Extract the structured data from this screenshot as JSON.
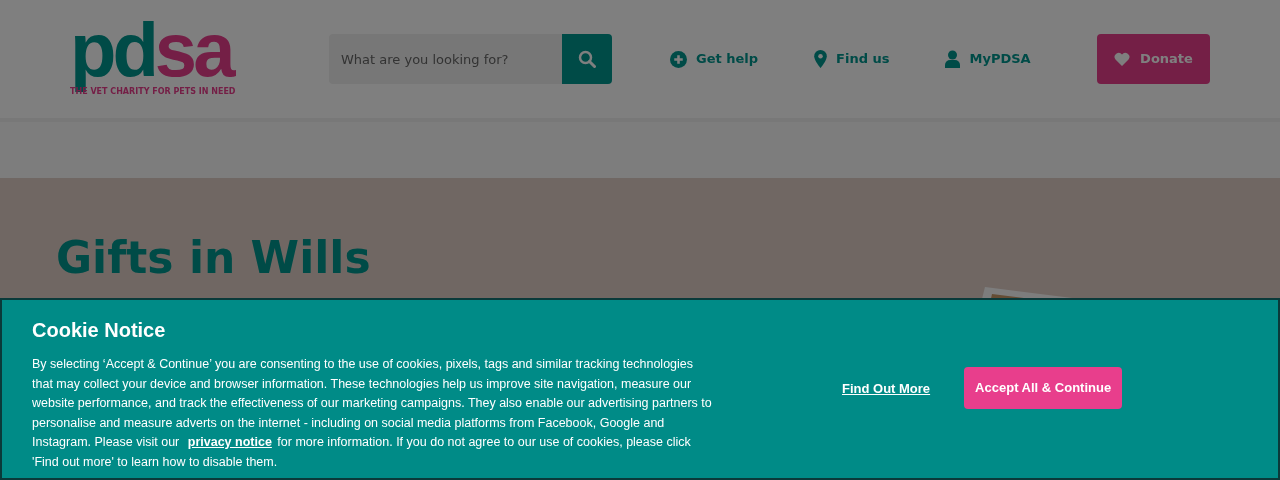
{
  "header": {
    "logo": {
      "part_1": "pd",
      "part_2": "sa",
      "tagline": "THE VET CHARITY FOR PETS IN NEED"
    },
    "search": {
      "placeholder": "What are you looking for?"
    },
    "nav": [
      {
        "kind": "help",
        "label": "Get help"
      },
      {
        "kind": "location",
        "label": "Find us"
      },
      {
        "kind": "account",
        "label": "MyPDSA"
      }
    ],
    "donate": "Donate"
  },
  "hero": {
    "title": "Gifts in Wills"
  },
  "cookie_notice": {
    "title": "Cookie Notice",
    "body_before_link": "By selecting ‘Accept & Continue’ you are consenting to the use of cookies, pixels, tags and similar tracking technologies that may collect your device and browser information. These technologies help us improve site navigation, measure our website performance, and track the effectiveness of our marketing campaigns. They also enable our advertising partners to personalise and measure adverts on the internet - including on social media platforms from Facebook, Google and Instagram. Please visit our",
    "link": "privacy notice",
    "body_after_link": "for more information. If you do not agree to our use of cookies, please click 'Find out more' to learn how to disable them.",
    "find_out_more": "Find Out More",
    "accept": "Accept All & Continue"
  }
}
